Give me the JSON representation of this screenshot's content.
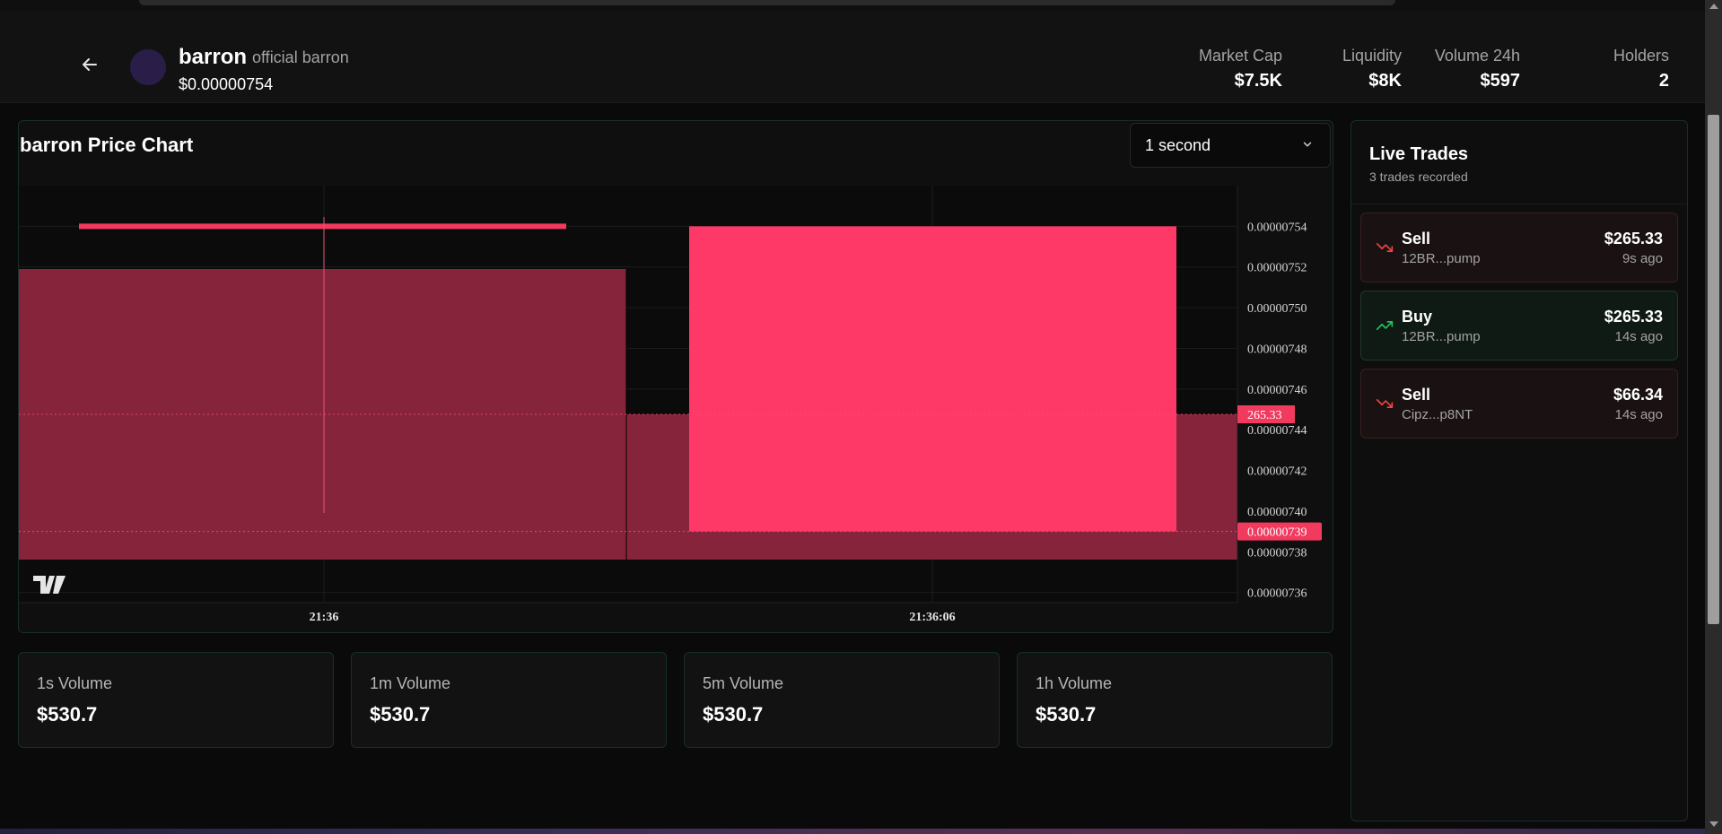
{
  "token": {
    "name": "barron",
    "full_name": "official barron",
    "price": "$0.00000754"
  },
  "stats": [
    {
      "label": "Market Cap",
      "value": "$7.5K"
    },
    {
      "label": "Liquidity",
      "value": "$8K"
    },
    {
      "label": "Volume 24h",
      "value": "$597"
    },
    {
      "label": "Holders",
      "value": "2"
    }
  ],
  "chart": {
    "title": "barron Price Chart",
    "interval": "1 second"
  },
  "chart_data": {
    "type": "candlestick",
    "x": [
      "21:36",
      "21:36:06"
    ],
    "y_ticks": [
      "0.00000754",
      "0.00000752",
      "0.00000750",
      "0.00000748",
      "0.00000746",
      "0.00000744",
      "0.00000742",
      "0.00000740",
      "0.00000738",
      "0.00000736"
    ],
    "ylim": [
      7.355e-06,
      7.56e-06
    ],
    "price_badge": "0.00000739",
    "volume_badge": "265.33",
    "candles": [
      {
        "open": 7.54e-06,
        "close": 7.54e-06,
        "color": "#f23a5f"
      },
      {
        "open": 7.54e-06,
        "close": 7.39e-06,
        "color": "#fe3867"
      }
    ],
    "volume": [
      {
        "value": 530.7,
        "color": "#86243c"
      },
      {
        "value": 265.33,
        "color": "#86243c"
      }
    ],
    "vol_max": 530.7
  },
  "volumes": [
    {
      "label": "1s Volume",
      "value": "$530.7"
    },
    {
      "label": "1m Volume",
      "value": "$530.7"
    },
    {
      "label": "5m Volume",
      "value": "$530.7"
    },
    {
      "label": "1h Volume",
      "value": "$530.7"
    }
  ],
  "trades_panel": {
    "title": "Live Trades",
    "subtitle": "3 trades recorded",
    "trades": [
      {
        "side": "Sell",
        "address": "12BR...pump",
        "amount": "$265.33",
        "ago": "9s ago"
      },
      {
        "side": "Buy",
        "address": "12BR...pump",
        "amount": "$265.33",
        "ago": "14s ago"
      },
      {
        "side": "Sell",
        "address": "Cipz...p8NT",
        "amount": "$66.34",
        "ago": "14s ago"
      }
    ]
  },
  "icons": {
    "back": "arrow-left-icon",
    "chevron": "chevron-down-icon",
    "sell": "trending-down-icon",
    "buy": "trending-up-icon",
    "logo": "tradingview-logo-icon"
  },
  "colors": {
    "sell": "#ef4444",
    "buy": "#22c55e",
    "candle": "#fe3867",
    "volume": "#86243c"
  }
}
